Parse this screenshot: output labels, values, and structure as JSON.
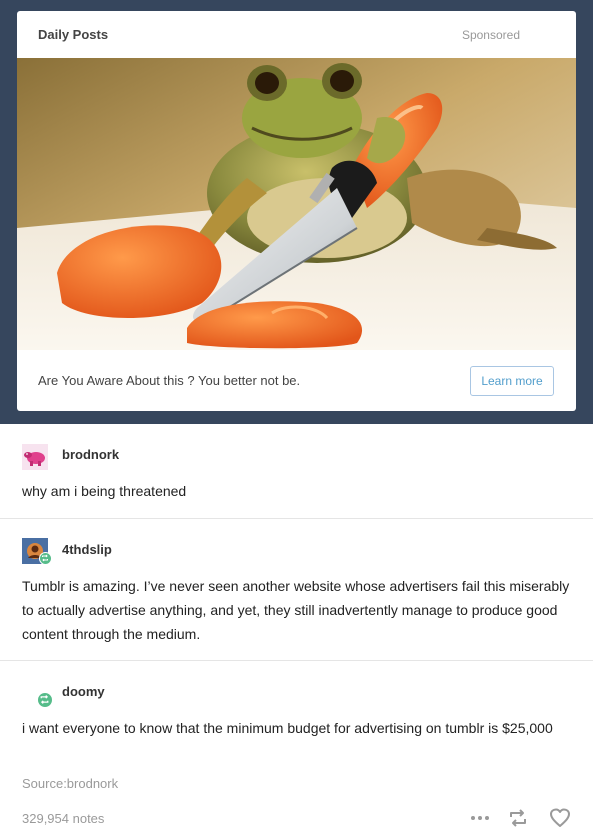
{
  "ad": {
    "title": "Daily Posts",
    "sponsored": "Sponsored",
    "caption": "Are You Aware About this ? You better not be.",
    "learn_more": "Learn more"
  },
  "posts": [
    {
      "username": "brodnork",
      "text": "why am i being threatened"
    },
    {
      "username": "4thdslip",
      "text": "Tumblr is amazing. I’ve never seen another website whose advertisers fail this miserably to actually advertise anything, and yet, they still inadvertently manage to produce good content through the medium."
    },
    {
      "username": "doomy",
      "text": "i want everyone to know that the minimum budget for advertising on tumblr is $25,000"
    }
  ],
  "footer": {
    "source": "Source:brodnork",
    "notes": "329,954 notes"
  },
  "colors": {
    "dashboard_bg": "#36465d",
    "link_blue": "#529ecc",
    "reblog_green": "#56bc8a"
  },
  "icons": [
    "frog-knife-image",
    "brodnork-avatar",
    "4thdslip-avatar",
    "reblog-badge-icon",
    "more-dots-icon",
    "reblog-icon",
    "heart-icon"
  ]
}
